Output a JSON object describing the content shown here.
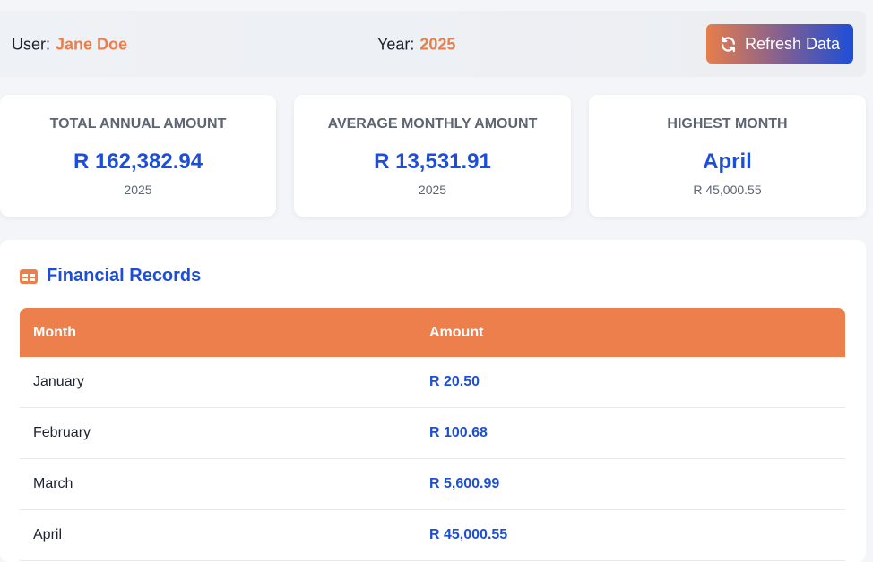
{
  "header": {
    "user_label": "User:",
    "user_name": "Jane Doe",
    "year_label": "Year:",
    "year_value": "2025",
    "refresh_label": "Refresh Data",
    "refresh_icon": "refresh-icon"
  },
  "cards": [
    {
      "title": "TOTAL ANNUAL AMOUNT",
      "value": "R 162,382.94",
      "sub": "2025"
    },
    {
      "title": "AVERAGE MONTHLY AMOUNT",
      "value": "R 13,531.91",
      "sub": "2025"
    },
    {
      "title": "HIGHEST MONTH",
      "value": "April",
      "sub": "R 45,000.55"
    }
  ],
  "records": {
    "title": "Financial Records",
    "icon": "table-icon",
    "columns": [
      "Month",
      "Amount"
    ],
    "rows": [
      {
        "month": "January",
        "amount": "R 20.50"
      },
      {
        "month": "February",
        "amount": "R 100.68"
      },
      {
        "month": "March",
        "amount": "R 5,600.99"
      },
      {
        "month": "April",
        "amount": "R 45,000.55"
      }
    ]
  },
  "colors": {
    "accent_orange": "#ec7f4c",
    "accent_blue": "#1d4ed8",
    "background": "#f3f5f9"
  }
}
